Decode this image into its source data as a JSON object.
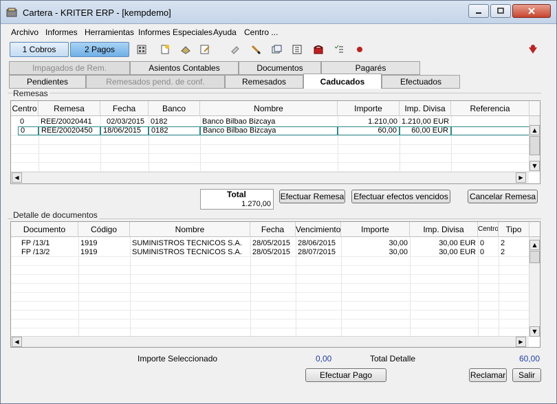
{
  "window": {
    "title": "Cartera - KRITER ERP - [kempdemo]"
  },
  "menu": [
    "Archivo",
    "Informes",
    "Herramientas",
    "Informes Especiales",
    "Ayuda",
    "Centro ..."
  ],
  "toolbar": {
    "cobros": "1 Cobros",
    "pagos": "2 Pagos"
  },
  "tabs_row1": [
    "Impagados de Rem.",
    "Asientos Contables",
    "Documentos",
    "Pagarés"
  ],
  "tabs_row2": [
    "Pendientes",
    "Remesados pend. de conf.",
    "Remesados",
    "Caducados",
    "Efectuados"
  ],
  "remesas": {
    "label": "Remesas",
    "columns": [
      "Centro",
      "Remesa",
      "Fecha",
      "Banco",
      "Nombre",
      "Importe",
      "Imp. Divisa",
      "Referencia"
    ],
    "rows": [
      {
        "centro": "0",
        "remesa": "REE/20020441",
        "fecha": "02/03/2015",
        "banco": "0182",
        "nombre": "Banco Bilbao Bizcaya",
        "importe": "1.210,00",
        "imp_divisa": "1.210,00 EUR",
        "referencia": ""
      },
      {
        "centro": "0",
        "remesa": "REE/20020450",
        "fecha": "18/06/2015",
        "banco": "0182",
        "nombre": "Banco Bilbao Bizcaya",
        "importe": "60,00",
        "imp_divisa": "60,00 EUR",
        "referencia": ""
      }
    ]
  },
  "total": {
    "label": "Total",
    "value": "1.270,00"
  },
  "buttons": {
    "efectuar_remesa": "Efectuar Remesa",
    "efectuar_vencidos": "Efectuar efectos vencidos",
    "cancelar_remesa": "Cancelar Remesa",
    "efectuar_pago": "Efectuar Pago",
    "reclamar": "Reclamar",
    "salir": "Salir"
  },
  "detalle": {
    "label": "Detalle de documentos",
    "columns": [
      "Documento",
      "Código",
      "Nombre",
      "Fecha",
      "Vencimiento",
      "Importe",
      "Imp. Divisa",
      "Centro",
      "Tipo"
    ],
    "rows": [
      {
        "documento": "FP /13/1",
        "codigo": "1919",
        "nombre": "SUMINISTROS TECNICOS S.A.",
        "fecha": "28/05/2015",
        "vencimiento": "28/06/2015",
        "importe": "30,00",
        "imp_divisa": "30,00 EUR",
        "centro": "0",
        "tipo": "2"
      },
      {
        "documento": "FP /13/2",
        "codigo": "1919",
        "nombre": "SUMINISTROS TECNICOS S.A.",
        "fecha": "28/05/2015",
        "vencimiento": "28/07/2015",
        "importe": "30,00",
        "imp_divisa": "30,00 EUR",
        "centro": "0",
        "tipo": "2"
      }
    ]
  },
  "footer": {
    "importe_seleccionado_label": "Importe Seleccionado",
    "importe_seleccionado_value": "0,00",
    "total_detalle_label": "Total Detalle",
    "total_detalle_value": "60,00"
  },
  "colors": {
    "accent_blue": "#1f3fa8",
    "selected_tab": "#ffffff",
    "active_toolbar": "#6fb0e6"
  }
}
